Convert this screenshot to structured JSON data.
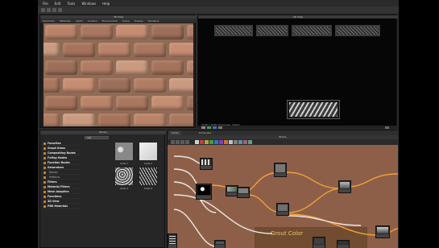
{
  "menu": [
    "File",
    "Edit",
    "Tools",
    "Windows",
    "Help"
  ],
  "view3d": {
    "title": "3D View",
    "menu": [
      "Geometry",
      "Materials",
      "Lights",
      "Camera",
      "Environment",
      "Scene",
      "Display",
      "Renderer"
    ]
  },
  "view2d": {
    "title": "2D View",
    "info": "2048 x 2048 (Grayscale, 16bpc)"
  },
  "library": {
    "title": "Library",
    "search_value": "cell",
    "tree": [
      {
        "label": "Favorites",
        "type": "head"
      },
      {
        "label": "Graph Items",
        "type": "head"
      },
      {
        "label": "Compositing Nodes",
        "type": "head"
      },
      {
        "label": "FxMap Nodes",
        "type": "head"
      },
      {
        "label": "Function Nodes",
        "type": "head"
      },
      {
        "label": "Generators",
        "type": "head"
      },
      {
        "label": "Noises",
        "type": "sub"
      },
      {
        "label": "Patterns",
        "type": "sub"
      },
      {
        "label": "Filters",
        "type": "head"
      },
      {
        "label": "Material Filters",
        "type": "head"
      },
      {
        "label": "Mesh Adaptive",
        "type": "head"
      },
      {
        "label": "Functions",
        "type": "head"
      },
      {
        "label": "3D View",
        "type": "head"
      },
      {
        "label": "PBR Materials",
        "type": "head"
      }
    ],
    "thumbs": [
      {
        "label": "Cells 1"
      },
      {
        "label": "Cells 2"
      },
      {
        "label": "Cells 3"
      },
      {
        "label": "Cells 4"
      }
    ]
  },
  "graph": {
    "tab_main": "bricks",
    "tab_other": "bricks.sbs",
    "title": "Bricks",
    "frame_label": "Grout Color",
    "colors": {
      "canvas": "#8e5f48",
      "wire_orange": "#f0a038",
      "wire_white": "#e8e8e8"
    }
  }
}
